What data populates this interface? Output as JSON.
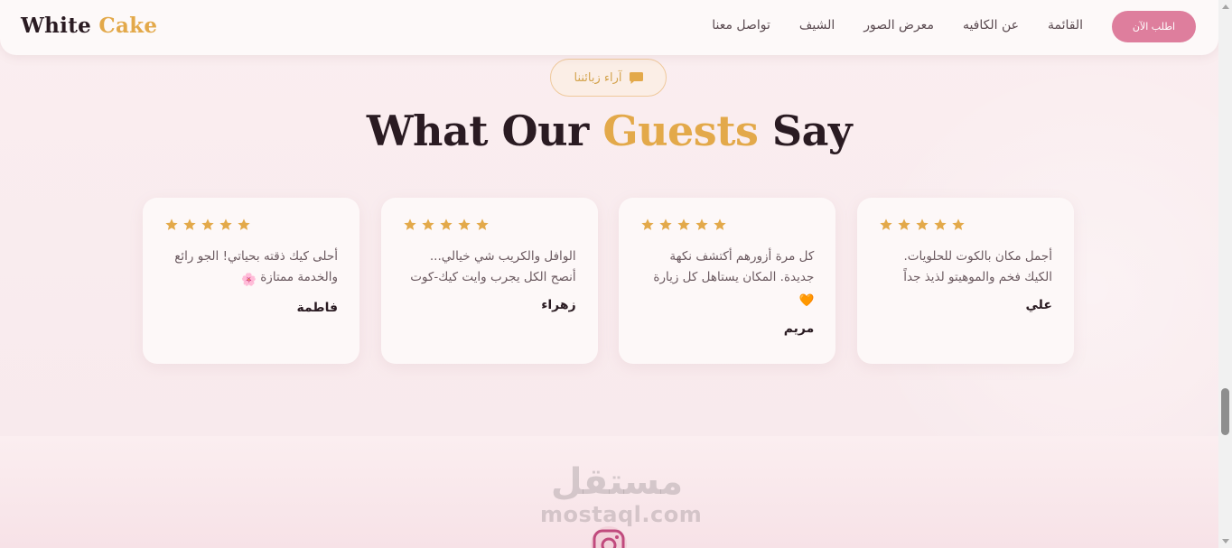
{
  "header": {
    "logo_main": "White",
    "logo_accent": "Cake",
    "nav": [
      "تواصل معنا",
      "الشيف",
      "معرض الصور",
      "عن الكافيه",
      "القائمة"
    ],
    "order_button": "اطلب الآن"
  },
  "section": {
    "badge_icon": "chat-bubble-icon",
    "badge_label": "آراء زبائننا",
    "title_part1": "What Our",
    "title_accent": "Guests",
    "title_part2": "Say"
  },
  "reviews": [
    {
      "rating": 5,
      "text": "أجمل مكان بالكوت للحلويات. الكيك فخم والموهيتو لذيذ جداً",
      "emoji": "",
      "name": "علي"
    },
    {
      "rating": 5,
      "text": "كل مرة أزورهم أكتشف نكهة جديدة. المكان يستاهل كل زيارة",
      "emoji": "🧡",
      "name": "مريم"
    },
    {
      "rating": 5,
      "text": "الوافل والكريب شي خيالي... أنصح الكل يجرب وايت كيك-كوت",
      "emoji": "",
      "name": "زهراء"
    },
    {
      "rating": 5,
      "text": "أحلى كيك ذقته بحياتي! الجو رائع والخدمة ممتازة",
      "emoji": "🌸",
      "name": "فاطمة"
    }
  ],
  "watermark": {
    "arabic": "مستقل",
    "latin": "mostaql.com"
  },
  "colors": {
    "accent_gold": "#e3a94a",
    "accent_pink": "#de7e9d",
    "dark_text": "#2a1b22",
    "star": "#e3a94a"
  },
  "footer_icon": "instagram-icon"
}
